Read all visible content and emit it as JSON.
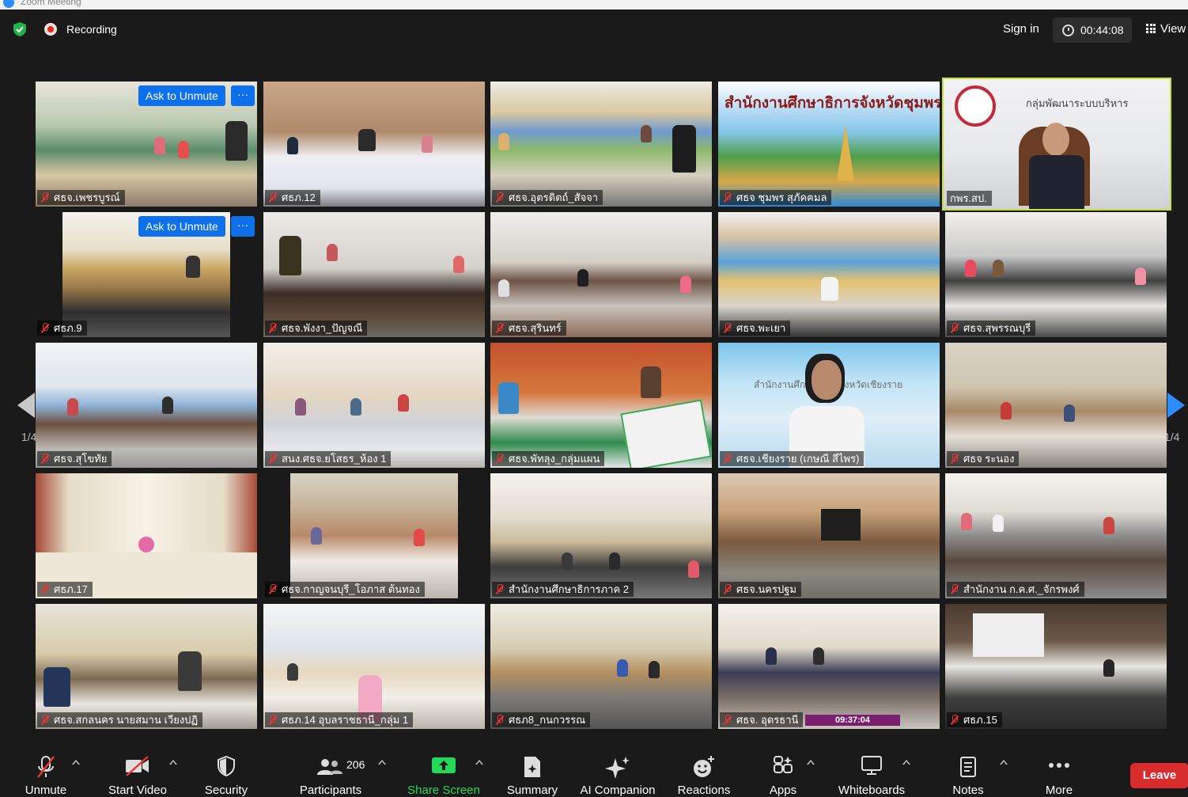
{
  "window": {
    "title": "Zoom Meeting"
  },
  "topbar": {
    "recording_label": "Recording",
    "signin_label": "Sign in",
    "timer": "00:44:08",
    "view_label": "View"
  },
  "gallery": {
    "page_left": "1/4",
    "page_right": "1/4",
    "ask_to_unmute": "Ask to Unmute",
    "more": "···",
    "tiles": [
      {
        "name": "ศธจ.เพชรบูรณ์"
      },
      {
        "name": "ศธภ.12"
      },
      {
        "name": "ศธจ.อุตรดิตถ์_สัจจา"
      },
      {
        "name": "ศธจ ชุมพร สุภัคฅมล"
      },
      {
        "name": "กพร.สป."
      },
      {
        "name": "ศธภ.9"
      },
      {
        "name": "ศธจ.พังงา_ปัญจณี"
      },
      {
        "name": "ศธจ.สุรินทร์"
      },
      {
        "name": "ศธจ.พะเยา"
      },
      {
        "name": "ศธจ.สุพรรณบุรี"
      },
      {
        "name": "ศธจ.สุโขทัย"
      },
      {
        "name": "สนง.ศธจ.ยโสธร_ห้อง 1"
      },
      {
        "name": "ศธจ.พัทลุง_กลุ่มแผน"
      },
      {
        "name": "ศธจ.เชียงราย (เกษณี  สีไพร)"
      },
      {
        "name": "ศธจ ระนอง"
      },
      {
        "name": "ศธภ.17"
      },
      {
        "name": "ศธจ.กาญจนบุรี_โอภาส ต้นทอง"
      },
      {
        "name": "สำนักงานศึกษาธิการภาค 2"
      },
      {
        "name": "ศธจ.นครปฐม"
      },
      {
        "name": "สำนักงาน ก.ค.ศ._จักรพงศ์"
      },
      {
        "name": "ศธจ.สกลนคร นายสมาน เวียงปฏิ"
      },
      {
        "name": "ศธภ.14 อุบลราชธานี_กลุ่ม 1"
      },
      {
        "name": "ศธภ8_กนกวรรณ"
      },
      {
        "name": "ศธจ. อุดรธานี"
      },
      {
        "name": "ศธภ.15"
      }
    ],
    "banner_chumphon": "สำนักงานศึกษาธิการจังหวัดชุมพร",
    "banner_kpr": "กลุ่มพัฒนาระบบบริหาร",
    "banner_chiangrai": "สำนักงานศึกษาธิการจังหวัดเชียงราย",
    "udon_clock": "09:37:04"
  },
  "toolbar": {
    "unmute": "Unmute",
    "start_video": "Start Video",
    "security": "Security",
    "participants": "Participants",
    "participant_count": "206",
    "share_screen": "Share Screen",
    "summary": "Summary",
    "ai_companion": "AI Companion",
    "reactions": "Reactions",
    "apps": "Apps",
    "whiteboards": "Whiteboards",
    "notes": "Notes",
    "more": "More",
    "leave": "Leave"
  },
  "colors": {
    "accent_blue": "#0e71eb",
    "share_green": "#23d959",
    "leave_red": "#d92d2d",
    "speaker_outline": "#c4e23a"
  }
}
